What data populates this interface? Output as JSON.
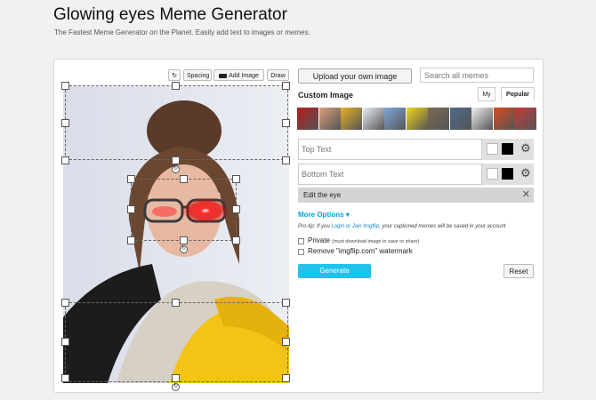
{
  "page": {
    "title": "Glowing eyes Meme Generator",
    "subtitle": "The Fastest Meme Generator on the Planet. Easily add text to images or memes."
  },
  "toolbar": {
    "rotate_icon": "↻",
    "spacing_label": "Spacing",
    "add_image_label": "Add Image",
    "draw_label": "Draw"
  },
  "upload_label": "Upload your own image",
  "search": {
    "placeholder": "Search all memes"
  },
  "custom_image_label": "Custom Image",
  "tabs": {
    "my": "My",
    "popular": "Popular"
  },
  "thumbnails": [
    {
      "name": "thumb-1",
      "color": "#b11d1d"
    },
    {
      "name": "thumb-2",
      "color": "#d8a07a"
    },
    {
      "name": "thumb-3",
      "color": "#e8b12a"
    },
    {
      "name": "thumb-4",
      "color": "#e9eef7"
    },
    {
      "name": "thumb-5",
      "color": "#7fa7d8"
    },
    {
      "name": "thumb-6",
      "color": "#f1d71c"
    },
    {
      "name": "thumb-7",
      "color": "#7b6a55"
    },
    {
      "name": "thumb-8",
      "color": "#4a6b8a"
    },
    {
      "name": "thumb-9",
      "color": "#f2f2f2"
    },
    {
      "name": "thumb-10",
      "color": "#d84a1e"
    },
    {
      "name": "thumb-11",
      "color": "#c43a3a"
    }
  ],
  "text_boxes": [
    {
      "placeholder": "Top Text"
    },
    {
      "placeholder": "Bottom Text"
    }
  ],
  "edit_layer": {
    "label": "Edit the eye",
    "close": "✕"
  },
  "more_options": "More Options ▾",
  "protip": {
    "prefix": "Pro-tip: If you ",
    "login": "Login or Join Imgflip",
    "suffix": ", your captioned memes will be saved in your account"
  },
  "private": {
    "label": "Private",
    "note": "(must download image to save or share)"
  },
  "watermark": {
    "label": "Remove \"imgflip.com\" watermark"
  },
  "generate_label": "Generate",
  "reset_label": "Reset",
  "colors": {
    "accent": "#1ec3ec",
    "link": "#0a84c8"
  }
}
